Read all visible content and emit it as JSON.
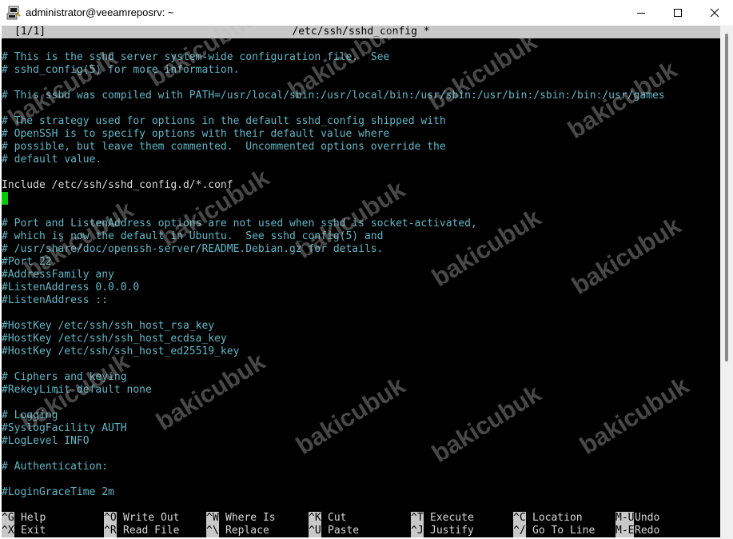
{
  "window": {
    "title": "administrator@veeamreposrv: ~",
    "icon": "putty-icon",
    "minimize_icon": "minimize-icon",
    "maximize_icon": "maximize-icon",
    "close_icon": "close-icon"
  },
  "nano": {
    "position": "[1/1]",
    "filename": "/etc/ssh/sshd_config *",
    "lines": [
      {
        "text": "# This is the sshd server system-wide configuration file.  See",
        "kind": "comment"
      },
      {
        "text": "# sshd_config(5) for more information.",
        "kind": "comment"
      },
      {
        "text": "",
        "kind": "blank"
      },
      {
        "text": "# This sshd was compiled with PATH=/usr/local/sbin:/usr/local/bin:/usr/sbin:/usr/bin:/sbin:/bin:/usr/games",
        "kind": "comment"
      },
      {
        "text": "",
        "kind": "blank"
      },
      {
        "text": "# The strategy used for options in the default sshd_config shipped with",
        "kind": "comment"
      },
      {
        "text": "# OpenSSH is to specify options with their default value where",
        "kind": "comment"
      },
      {
        "text": "# possible, but leave them commented.  Uncommented options override the",
        "kind": "comment"
      },
      {
        "text": "# default value.",
        "kind": "comment"
      },
      {
        "text": "",
        "kind": "blank"
      },
      {
        "text": "Include /etc/ssh/sshd_config.d/*.conf",
        "kind": "plain"
      },
      {
        "text": "",
        "kind": "cursor"
      },
      {
        "text": "",
        "kind": "blank"
      },
      {
        "text": "# Port and ListenAddress options are not used when sshd is socket-activated,",
        "kind": "comment"
      },
      {
        "text": "# which is now the default in Ubuntu.  See sshd_config(5) and",
        "kind": "comment"
      },
      {
        "text": "# /usr/share/doc/openssh-server/README.Debian.gz for details.",
        "kind": "comment"
      },
      {
        "text": "#Port 22",
        "kind": "comment"
      },
      {
        "text": "#AddressFamily any",
        "kind": "comment"
      },
      {
        "text": "#ListenAddress 0.0.0.0",
        "kind": "comment"
      },
      {
        "text": "#ListenAddress ::",
        "kind": "comment"
      },
      {
        "text": "",
        "kind": "blank"
      },
      {
        "text": "#HostKey /etc/ssh/ssh_host_rsa_key",
        "kind": "comment"
      },
      {
        "text": "#HostKey /etc/ssh/ssh_host_ecdsa_key",
        "kind": "comment"
      },
      {
        "text": "#HostKey /etc/ssh/ssh_host_ed25519_key",
        "kind": "comment"
      },
      {
        "text": "",
        "kind": "blank"
      },
      {
        "text": "# Ciphers and keying",
        "kind": "comment"
      },
      {
        "text": "#RekeyLimit default none",
        "kind": "comment"
      },
      {
        "text": "",
        "kind": "blank"
      },
      {
        "text": "# Logging",
        "kind": "comment"
      },
      {
        "text": "#SyslogFacility AUTH",
        "kind": "comment"
      },
      {
        "text": "#LogLevel INFO",
        "kind": "comment"
      },
      {
        "text": "",
        "kind": "blank"
      },
      {
        "text": "# Authentication:",
        "kind": "comment"
      },
      {
        "text": "",
        "kind": "blank"
      },
      {
        "text": "#LoginGraceTime 2m",
        "kind": "comment"
      }
    ],
    "shortcuts": [
      [
        {
          "key": "^G",
          "label": "Help"
        },
        {
          "key": "^X",
          "label": "Exit"
        }
      ],
      [
        {
          "key": "^O",
          "label": "Write Out"
        },
        {
          "key": "^R",
          "label": "Read File"
        }
      ],
      [
        {
          "key": "^W",
          "label": "Where Is"
        },
        {
          "key": "^\\",
          "label": "Replace"
        }
      ],
      [
        {
          "key": "^K",
          "label": "Cut"
        },
        {
          "key": "^U",
          "label": "Paste"
        }
      ],
      [
        {
          "key": "^T",
          "label": "Execute"
        },
        {
          "key": "^J",
          "label": "Justify"
        }
      ],
      [
        {
          "key": "^C",
          "label": "Location"
        },
        {
          "key": "^/",
          "label": "Go To Line"
        }
      ],
      [
        {
          "key": "M-U",
          "label": "Undo"
        },
        {
          "key": "M-E",
          "label": "Redo"
        }
      ]
    ]
  },
  "watermark": "bakicubuk",
  "colors": {
    "terminal_bg": "#000000",
    "comment": "#5fb7c8",
    "plain": "#d8d8d8",
    "cursor": "#00cc00",
    "bar": "#c8c8c8"
  }
}
